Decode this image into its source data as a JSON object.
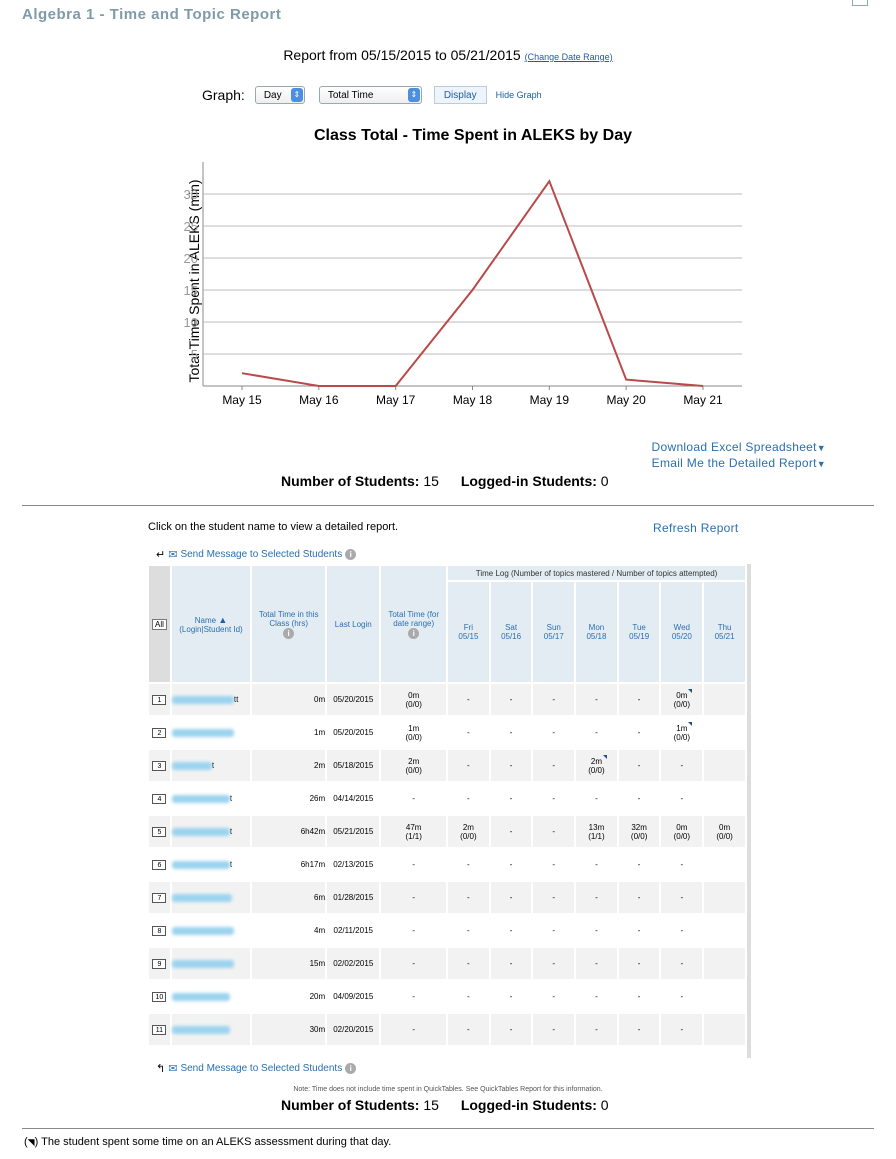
{
  "page_title": "Algebra 1 - Time and Topic Report",
  "report_range": {
    "text": "Report from 05/15/2015 to 05/21/2015",
    "change_link": "(Change Date Range)"
  },
  "graph_controls": {
    "label": "Graph:",
    "period_value": "Day",
    "metric_value": "Total Time",
    "display_button": "Display",
    "hide_graph": "Hide Graph"
  },
  "chart_data": {
    "type": "line",
    "title": "Class Total - Time Spent in ALEKS by Day",
    "ylabel": "Total Time Spent in ALEKS (min)",
    "xlabel": "",
    "categories": [
      "May 15",
      "May 16",
      "May 17",
      "May 18",
      "May 19",
      "May 20",
      "May 21"
    ],
    "values": [
      2,
      0,
      0,
      15,
      32,
      1,
      0
    ],
    "yticks": [
      "5",
      "10",
      "15",
      "20",
      "25",
      "30"
    ],
    "ylim": [
      0,
      35
    ],
    "grid": true,
    "line_color": "#b94a4a"
  },
  "links": {
    "download_excel": "Download Excel Spreadsheet",
    "email_report": "Email Me the Detailed Report",
    "refresh_report": "Refresh Report"
  },
  "stats": {
    "students_label": "Number of Students:",
    "students_value": "15",
    "logged_label": "Logged-in Students:",
    "logged_value": "0"
  },
  "instructions": "Click on the student name to view a detailed report.",
  "send_message": "Send Message to Selected Students",
  "table": {
    "all_button": "All",
    "col_name": "Name",
    "col_name_sub": "(Login|Student Id)",
    "col_total_time": "Total Time in this Class (hrs)",
    "col_last_login": "Last Login",
    "col_range_time": "Total Time (for date range)",
    "time_log_header": "Time Log (Number of topics mastered / Number of topics attempted)",
    "days": [
      {
        "d": "Fri",
        "date": "05/15"
      },
      {
        "d": "Sat",
        "date": "05/16"
      },
      {
        "d": "Sun",
        "date": "05/17"
      },
      {
        "d": "Mon",
        "date": "05/18"
      },
      {
        "d": "Tue",
        "date": "05/19"
      },
      {
        "d": "Wed",
        "date": "05/20"
      },
      {
        "d": "Thu",
        "date": "05/21"
      }
    ],
    "rows": [
      {
        "num": "1",
        "tail": "tt",
        "total": "0m",
        "last": "05/20/2015",
        "range": "0m",
        "range_sub": "(0/0)",
        "log": [
          [
            "-",
            ""
          ],
          [
            "-",
            ""
          ],
          [
            "-",
            ""
          ],
          [
            "-",
            ""
          ],
          [
            "-",
            ""
          ],
          [
            "0m",
            "(0/0)"
          ],
          [
            "",
            ""
          ]
        ],
        "corner": [
          5
        ]
      },
      {
        "num": "2",
        "tail": "",
        "total": "1m",
        "last": "05/20/2015",
        "range": "1m",
        "range_sub": "(0/0)",
        "log": [
          [
            "-",
            ""
          ],
          [
            "-",
            ""
          ],
          [
            "-",
            ""
          ],
          [
            "-",
            ""
          ],
          [
            "-",
            ""
          ],
          [
            "1m",
            "(0/0)"
          ],
          [
            "",
            ""
          ]
        ],
        "corner": [
          5
        ]
      },
      {
        "num": "3",
        "tail": "t",
        "total": "2m",
        "last": "05/18/2015",
        "range": "2m",
        "range_sub": "(0/0)",
        "log": [
          [
            "-",
            ""
          ],
          [
            "-",
            ""
          ],
          [
            "-",
            ""
          ],
          [
            "2m",
            "(0/0)"
          ],
          [
            "-",
            ""
          ],
          [
            "-",
            ""
          ],
          [
            "",
            ""
          ]
        ],
        "corner": [
          3
        ]
      },
      {
        "num": "4",
        "tail": "t",
        "total": "26m",
        "last": "04/14/2015",
        "range": "-",
        "range_sub": "",
        "log": [
          [
            "-",
            ""
          ],
          [
            "-",
            ""
          ],
          [
            "-",
            ""
          ],
          [
            "-",
            ""
          ],
          [
            "-",
            ""
          ],
          [
            "-",
            ""
          ],
          [
            "",
            ""
          ]
        ],
        "corner": []
      },
      {
        "num": "5",
        "tail": "t",
        "total": "6h42m",
        "last": "05/21/2015",
        "range": "47m",
        "range_sub": "(1/1)",
        "log": [
          [
            "2m",
            "(0/0)"
          ],
          [
            "-",
            ""
          ],
          [
            "-",
            ""
          ],
          [
            "13m",
            "(1/1)"
          ],
          [
            "32m",
            "(0/0)"
          ],
          [
            "0m",
            "(0/0)"
          ],
          [
            "0m",
            "(0/0)"
          ]
        ],
        "corner": []
      },
      {
        "num": "6",
        "tail": "t",
        "total": "6h17m",
        "last": "02/13/2015",
        "range": "-",
        "range_sub": "",
        "log": [
          [
            "-",
            ""
          ],
          [
            "-",
            ""
          ],
          [
            "-",
            ""
          ],
          [
            "-",
            ""
          ],
          [
            "-",
            ""
          ],
          [
            "-",
            ""
          ],
          [
            "",
            ""
          ]
        ],
        "corner": []
      },
      {
        "num": "7",
        "tail": "",
        "total": "6m",
        "last": "01/28/2015",
        "range": "-",
        "range_sub": "",
        "log": [
          [
            "-",
            ""
          ],
          [
            "-",
            ""
          ],
          [
            "-",
            ""
          ],
          [
            "-",
            ""
          ],
          [
            "-",
            ""
          ],
          [
            "-",
            ""
          ],
          [
            "",
            ""
          ]
        ],
        "corner": []
      },
      {
        "num": "8",
        "tail": "",
        "total": "4m",
        "last": "02/11/2015",
        "range": "-",
        "range_sub": "",
        "log": [
          [
            "-",
            ""
          ],
          [
            "-",
            ""
          ],
          [
            "-",
            ""
          ],
          [
            "-",
            ""
          ],
          [
            "-",
            ""
          ],
          [
            "-",
            ""
          ],
          [
            "",
            ""
          ]
        ],
        "corner": []
      },
      {
        "num": "9",
        "tail": "",
        "total": "15m",
        "last": "02/02/2015",
        "range": "-",
        "range_sub": "",
        "log": [
          [
            "-",
            ""
          ],
          [
            "-",
            ""
          ],
          [
            "-",
            ""
          ],
          [
            "-",
            ""
          ],
          [
            "-",
            ""
          ],
          [
            "-",
            ""
          ],
          [
            "",
            ""
          ]
        ],
        "corner": []
      },
      {
        "num": "10",
        "tail": "",
        "total": "20m",
        "last": "04/09/2015",
        "range": "-",
        "range_sub": "",
        "log": [
          [
            "-",
            ""
          ],
          [
            "-",
            ""
          ],
          [
            "-",
            ""
          ],
          [
            "-",
            ""
          ],
          [
            "-",
            ""
          ],
          [
            "-",
            ""
          ],
          [
            "",
            ""
          ]
        ],
        "corner": []
      },
      {
        "num": "11",
        "tail": "",
        "total": "30m",
        "last": "02/20/2015",
        "range": "-",
        "range_sub": "",
        "log": [
          [
            "-",
            ""
          ],
          [
            "-",
            ""
          ],
          [
            "-",
            ""
          ],
          [
            "-",
            ""
          ],
          [
            "-",
            ""
          ],
          [
            "-",
            ""
          ],
          [
            "",
            ""
          ]
        ],
        "corner": []
      }
    ]
  },
  "footnote": "Note: Time does not include time spent in QuickTables. See QuickTables Report for this information.",
  "legend_note": "The student spent some time on an ALEKS assessment during that day."
}
